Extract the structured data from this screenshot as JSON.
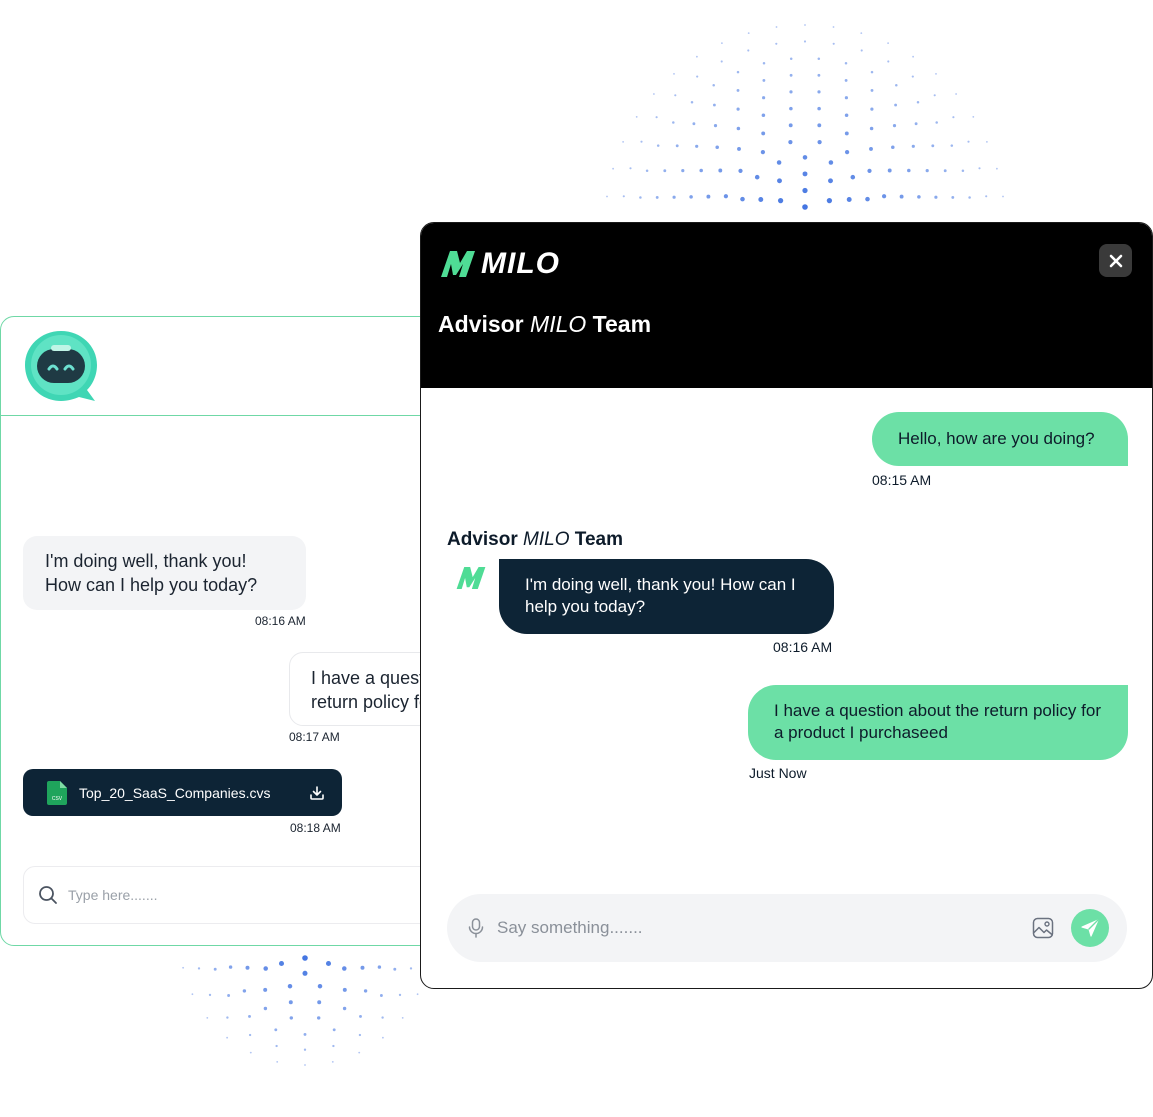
{
  "colors": {
    "accent_green": "#6ce0a6",
    "navy": "#0d2436",
    "header_black": "#000000",
    "dot_blue": "#3b6fe0"
  },
  "back_widget": {
    "avatar_icon": "robot-chat-avatar-icon",
    "messages": [
      {
        "text": "I'm doing well, thank you! How can I help you today?",
        "time": "08:16 AM"
      },
      {
        "text": "I have a question about the return policy for a product",
        "time": "08:17 AM"
      }
    ],
    "file": {
      "name": "Top_20_SaaS_Companies.cvs",
      "badge": "CSV",
      "time": "08:18 AM"
    },
    "input_placeholder": "Type here......."
  },
  "front_widget": {
    "logo_text": "MILO",
    "title_prefix": "Advisor",
    "title_brand": "MILO",
    "title_suffix": "Team",
    "messages": [
      {
        "from": "user",
        "text": "Hello, how are you doing?",
        "time": "08:15 AM"
      },
      {
        "from": "agent",
        "text": "I'm doing well, thank you! How can I help you today?",
        "time": "08:16 AM"
      },
      {
        "from": "user",
        "text": "I have a question about the return policy for a product I purchaseed",
        "time": "Just Now"
      }
    ],
    "agent_name_prefix": "Advisor",
    "agent_name_brand": "MILO",
    "agent_name_suffix": "Team",
    "input_placeholder": "Say something......."
  }
}
